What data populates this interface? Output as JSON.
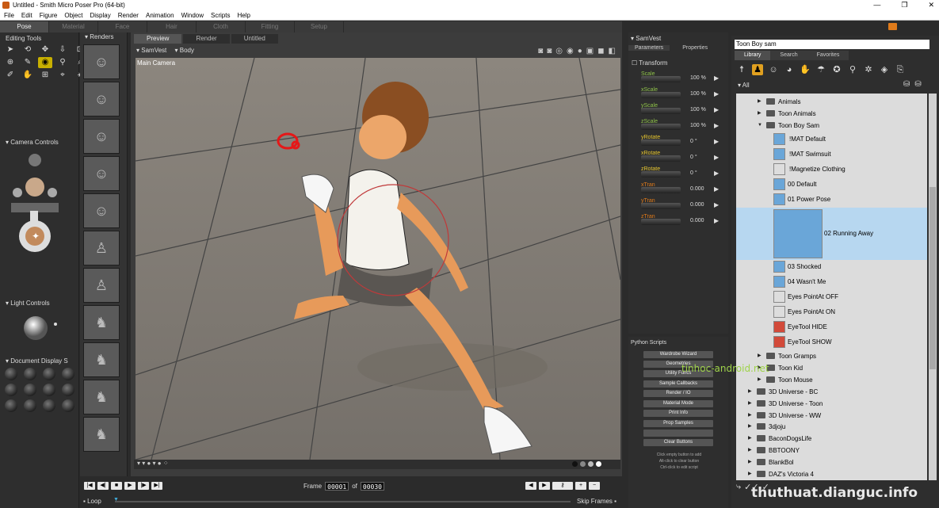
{
  "window": {
    "title": "Untitled - Smith Micro Poser Pro  (64-bit)",
    "controls": [
      "—",
      "❐",
      "✕"
    ]
  },
  "menu": [
    "File",
    "Edit",
    "Figure",
    "Object",
    "Display",
    "Render",
    "Animation",
    "Window",
    "Scripts",
    "Help"
  ],
  "rooms": [
    "Pose",
    "Material",
    "Face",
    "Hair",
    "Cloth",
    "Fitting",
    "Setup"
  ],
  "editing_tools": {
    "title": "Editing Tools",
    "icons": [
      "select-icon",
      "rotate-icon",
      "twist-icon",
      "translate-icon",
      "scale-icon",
      "taper-icon",
      "chain-break-icon",
      "color-icon",
      "grouping-icon",
      "view-magnifier-icon",
      "morph-brush-icon",
      "direct-manipulation-icon",
      "eye-dropper-icon",
      "zoom-icon",
      "wand-icon"
    ]
  },
  "camera_controls": {
    "title": "Camera Controls"
  },
  "light_controls": {
    "title": "Light Controls"
  },
  "document_display": {
    "title": "Document Display S"
  },
  "renders": {
    "title": "Renders",
    "count": 10
  },
  "viewport": {
    "tabs": [
      "Preview",
      "Render",
      "Untitled"
    ],
    "figure": "SamVest",
    "part": "Body",
    "camera": "Main Camera"
  },
  "timeline": {
    "frame_label": "Frame",
    "frame": "00001",
    "of_label": "of",
    "total": "00030",
    "loop_label": "Loop",
    "skip_label": "Skip Frames"
  },
  "params": {
    "object": "SamVest",
    "tabs": [
      "Parameters",
      "Properties"
    ],
    "group": "Transform",
    "items": [
      {
        "label": "Scale",
        "value": "100 %"
      },
      {
        "label": "xScale",
        "value": "100 %"
      },
      {
        "label": "yScale",
        "value": "100 %"
      },
      {
        "label": "zScale",
        "value": "100 %"
      },
      {
        "label": "yRotate",
        "value": "0 °"
      },
      {
        "label": "xRotate",
        "value": "0 °"
      },
      {
        "label": "zRotate",
        "value": "0 °"
      },
      {
        "label": "xTran",
        "value": "0.000"
      },
      {
        "label": "yTran",
        "value": "0.000"
      },
      {
        "label": "zTran",
        "value": "0.000"
      }
    ]
  },
  "python": {
    "title": "Python Scripts",
    "buttons": [
      "Wardrobe Wizard",
      "Geometries",
      "Utility Funcs",
      "Sample Callbacks",
      "Render / IO",
      "Material Mode",
      "Print Info",
      "Prop Samples",
      "",
      "Clear Buttons"
    ],
    "hints": [
      "Click empty button to add",
      "Alt-click to clear button",
      "Ctrl-click to edit script"
    ]
  },
  "library": {
    "search": "Toon Boy sam",
    "tabs": [
      "Library",
      "Search",
      "Favorites"
    ],
    "all_label": "All",
    "rows": [
      {
        "label": "Animals",
        "kind": "folder",
        "indent": 1
      },
      {
        "label": "Toon Animals",
        "kind": "folder",
        "indent": 1
      },
      {
        "label": "Toon Boy Sam",
        "kind": "folder-open",
        "indent": 1
      },
      {
        "label": "!MAT Default",
        "kind": "item",
        "indent": 2
      },
      {
        "label": "!MAT Swimsuit",
        "kind": "item",
        "indent": 2
      },
      {
        "label": "!Magnetize Clothing",
        "kind": "item",
        "indent": 2
      },
      {
        "label": "00 Default",
        "kind": "item",
        "indent": 2
      },
      {
        "label": "01 Power Pose",
        "kind": "item",
        "indent": 2
      },
      {
        "label": "02 Running Away",
        "kind": "item-large",
        "indent": 2,
        "selected": true
      },
      {
        "label": "03 Shocked",
        "kind": "item",
        "indent": 2
      },
      {
        "label": "04 Wasn't Me",
        "kind": "item",
        "indent": 2
      },
      {
        "label": "Eyes PointAt OFF",
        "kind": "item",
        "indent": 2
      },
      {
        "label": "Eyes PointAt ON",
        "kind": "item",
        "indent": 2
      },
      {
        "label": "EyeTool HIDE",
        "kind": "item",
        "indent": 2
      },
      {
        "label": "EyeTool SHOW",
        "kind": "item",
        "indent": 2
      },
      {
        "label": "Toon Gramps",
        "kind": "folder",
        "indent": 1
      },
      {
        "label": "Toon Kid",
        "kind": "folder",
        "indent": 1
      },
      {
        "label": "Toon Mouse",
        "kind": "folder",
        "indent": 1
      },
      {
        "label": "3D Universe - BC",
        "kind": "folder",
        "indent": 0
      },
      {
        "label": "3D Universe - Toon",
        "kind": "folder",
        "indent": 0
      },
      {
        "label": "3D Universe - WW",
        "kind": "folder",
        "indent": 0
      },
      {
        "label": "3djoju",
        "kind": "folder",
        "indent": 0
      },
      {
        "label": "BaconDogsLife",
        "kind": "folder",
        "indent": 0
      },
      {
        "label": "BBTOONY",
        "kind": "folder",
        "indent": 0
      },
      {
        "label": "BlankBol",
        "kind": "folder",
        "indent": 0
      },
      {
        "label": "DAZ's Victoria 4",
        "kind": "folder",
        "indent": 0
      }
    ]
  },
  "watermark": "thuthuat.dianguc.info",
  "watermark2": "tinhoc-android.net"
}
